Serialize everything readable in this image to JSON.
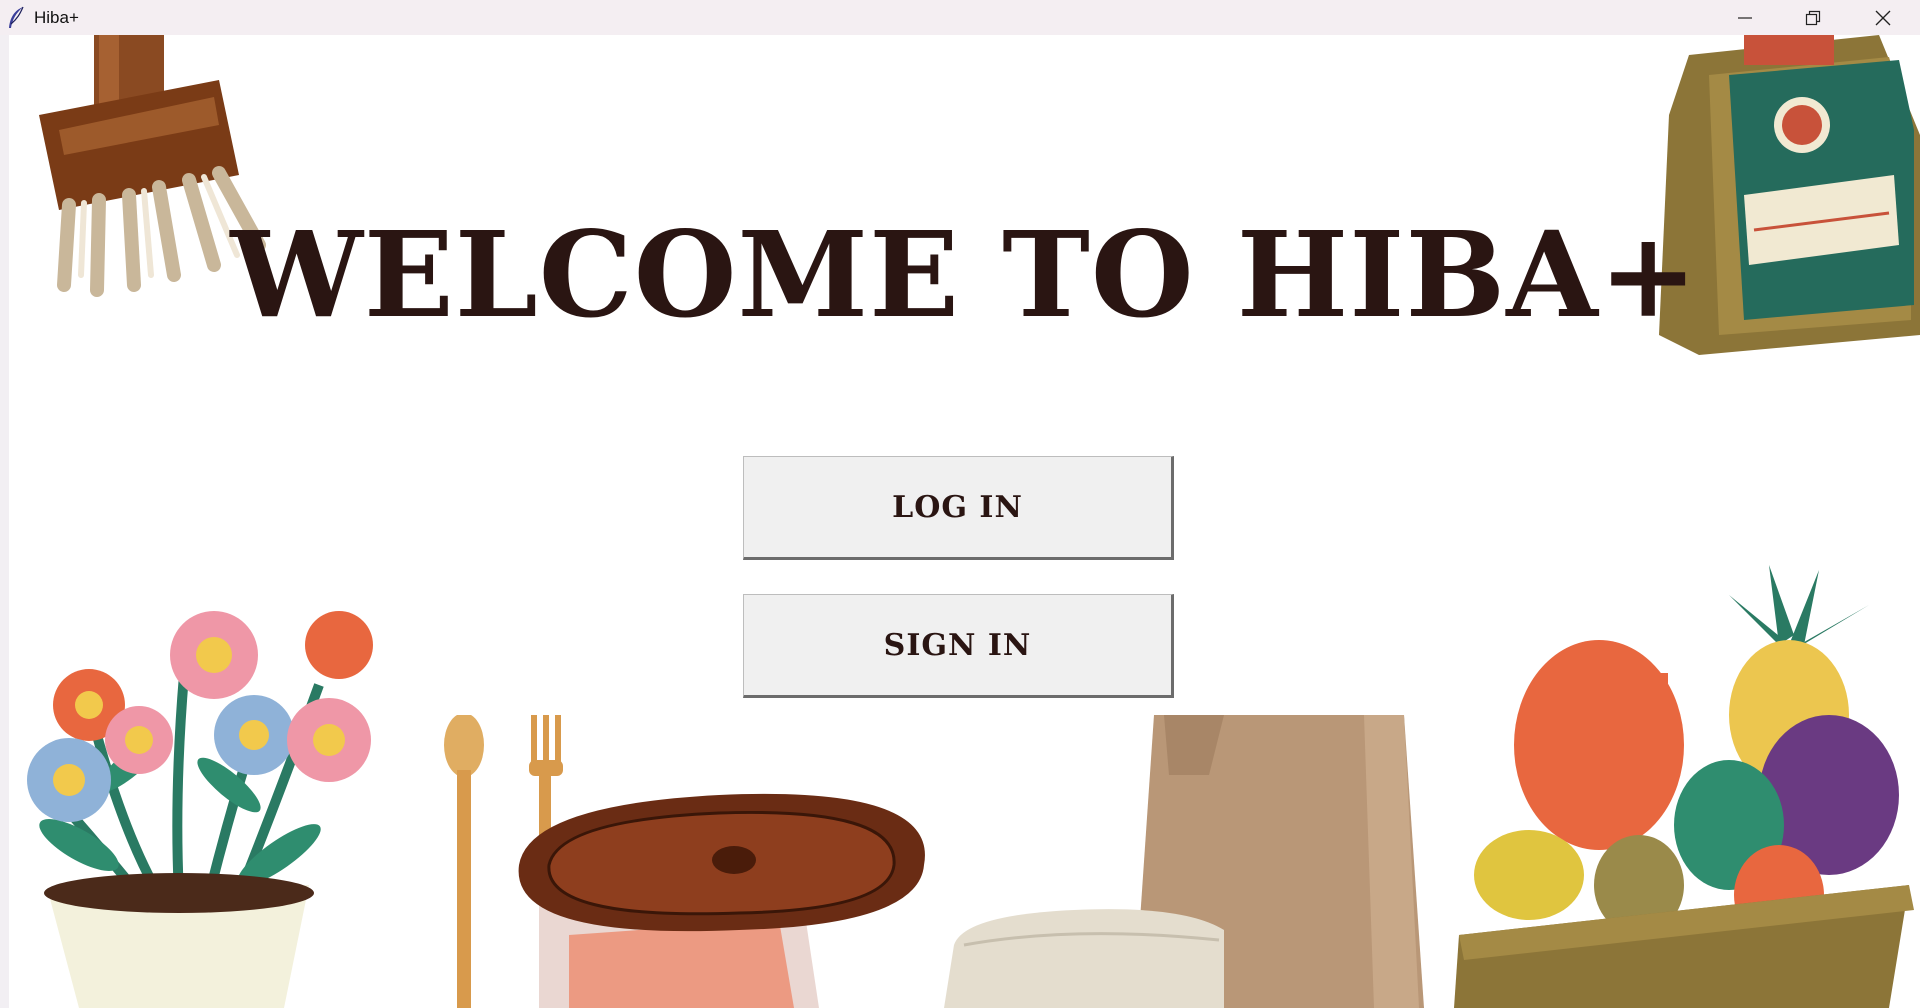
{
  "window": {
    "title": "Hiba+",
    "app_icon": "feather-icon",
    "controls": [
      "minimize-icon",
      "restore-icon",
      "close-icon"
    ]
  },
  "main": {
    "heading": "WELCOME TO HIBA+",
    "login_label": "LOG IN",
    "signin_label": "SIGN IN"
  },
  "colors": {
    "title_text": "#2a1512",
    "button_bg": "#f0f0f0",
    "titlebar_bg": "#f4eef2"
  }
}
